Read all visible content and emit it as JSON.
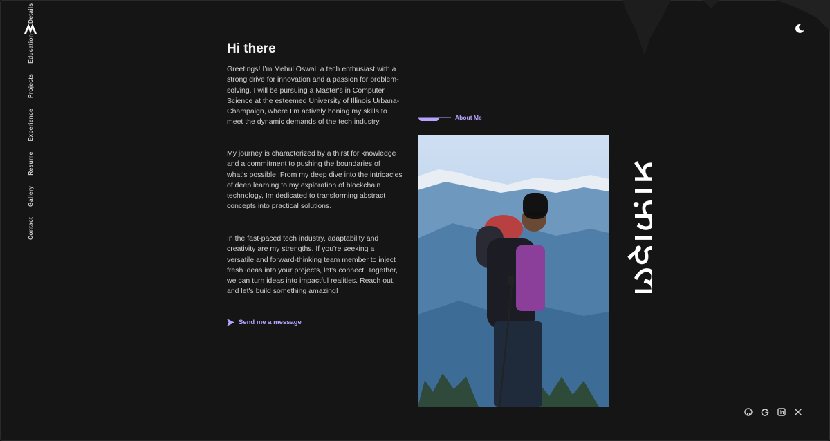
{
  "nav": {
    "items": [
      "Details",
      "Education",
      "Projects",
      "Experience",
      "Resume",
      "Gallery",
      "Contact"
    ]
  },
  "intro": {
    "title": "Hi there",
    "paragraphs": [
      "Greetings! I’m Mehul Oswal, a tech enthusiast with a strong drive for innovation and a passion for problem-solving. I will be pursuing a Master's in Computer Science at the esteemed University of Illinois Urbana-Champaign, where I’m actively honing my skills to meet the dynamic demands of the tech industry.",
      "My journey is characterized by a thirst for knowledge and a commitment to pushing the boundaries of what’s possible. From my deep dive into the intricacies of deep learning to my exploration of blockchain technology, Im dedicated to transforming abstract concepts into practical solutions.",
      "In the fast-paced tech industry, adaptability and creativity are my strengths. If you're seeking a versatile and forward-thinking team member to inject fresh ideas into your projects, let's connect. Together, we can turn ideas into impactful realities. Reach out, and let's build something amazing!"
    ],
    "send_label": "Send me a message"
  },
  "about": {
    "label": "About Me"
  },
  "decor_text": "प्रोफ़ाइल",
  "icons": {
    "logo": "logo-icon",
    "theme": "moon-icon",
    "send": "send-arrow-icon",
    "social": [
      "github-icon",
      "google-icon",
      "linkedin-icon",
      "x-icon"
    ]
  },
  "colors": {
    "accent": "#b7a3ff",
    "background": "#151515"
  }
}
